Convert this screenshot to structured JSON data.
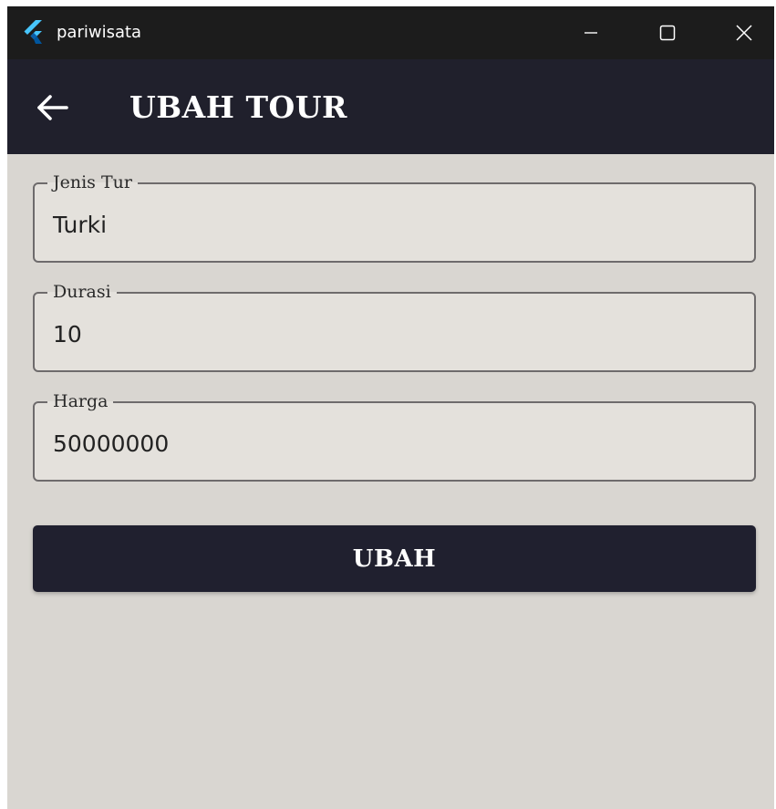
{
  "window": {
    "title": "pariwisata",
    "icon": "flutter-logo-icon",
    "controls": [
      "minimize-icon",
      "maximize-icon",
      "close-icon"
    ]
  },
  "appbar": {
    "back_icon": "arrow-left-icon",
    "title": "UBAH TOUR"
  },
  "form": {
    "fields": [
      {
        "label": "Jenis Tur",
        "value": "Turki"
      },
      {
        "label": "Durasi",
        "value": "10"
      },
      {
        "label": "Harga",
        "value": "50000000"
      }
    ],
    "submit_label": "UBAH"
  },
  "colors": {
    "titlebar": "#1c1c1c",
    "appbar": "#20202c",
    "background": "#d9d6d1",
    "field_fill": "#e4e1dc",
    "button": "#20202f"
  }
}
